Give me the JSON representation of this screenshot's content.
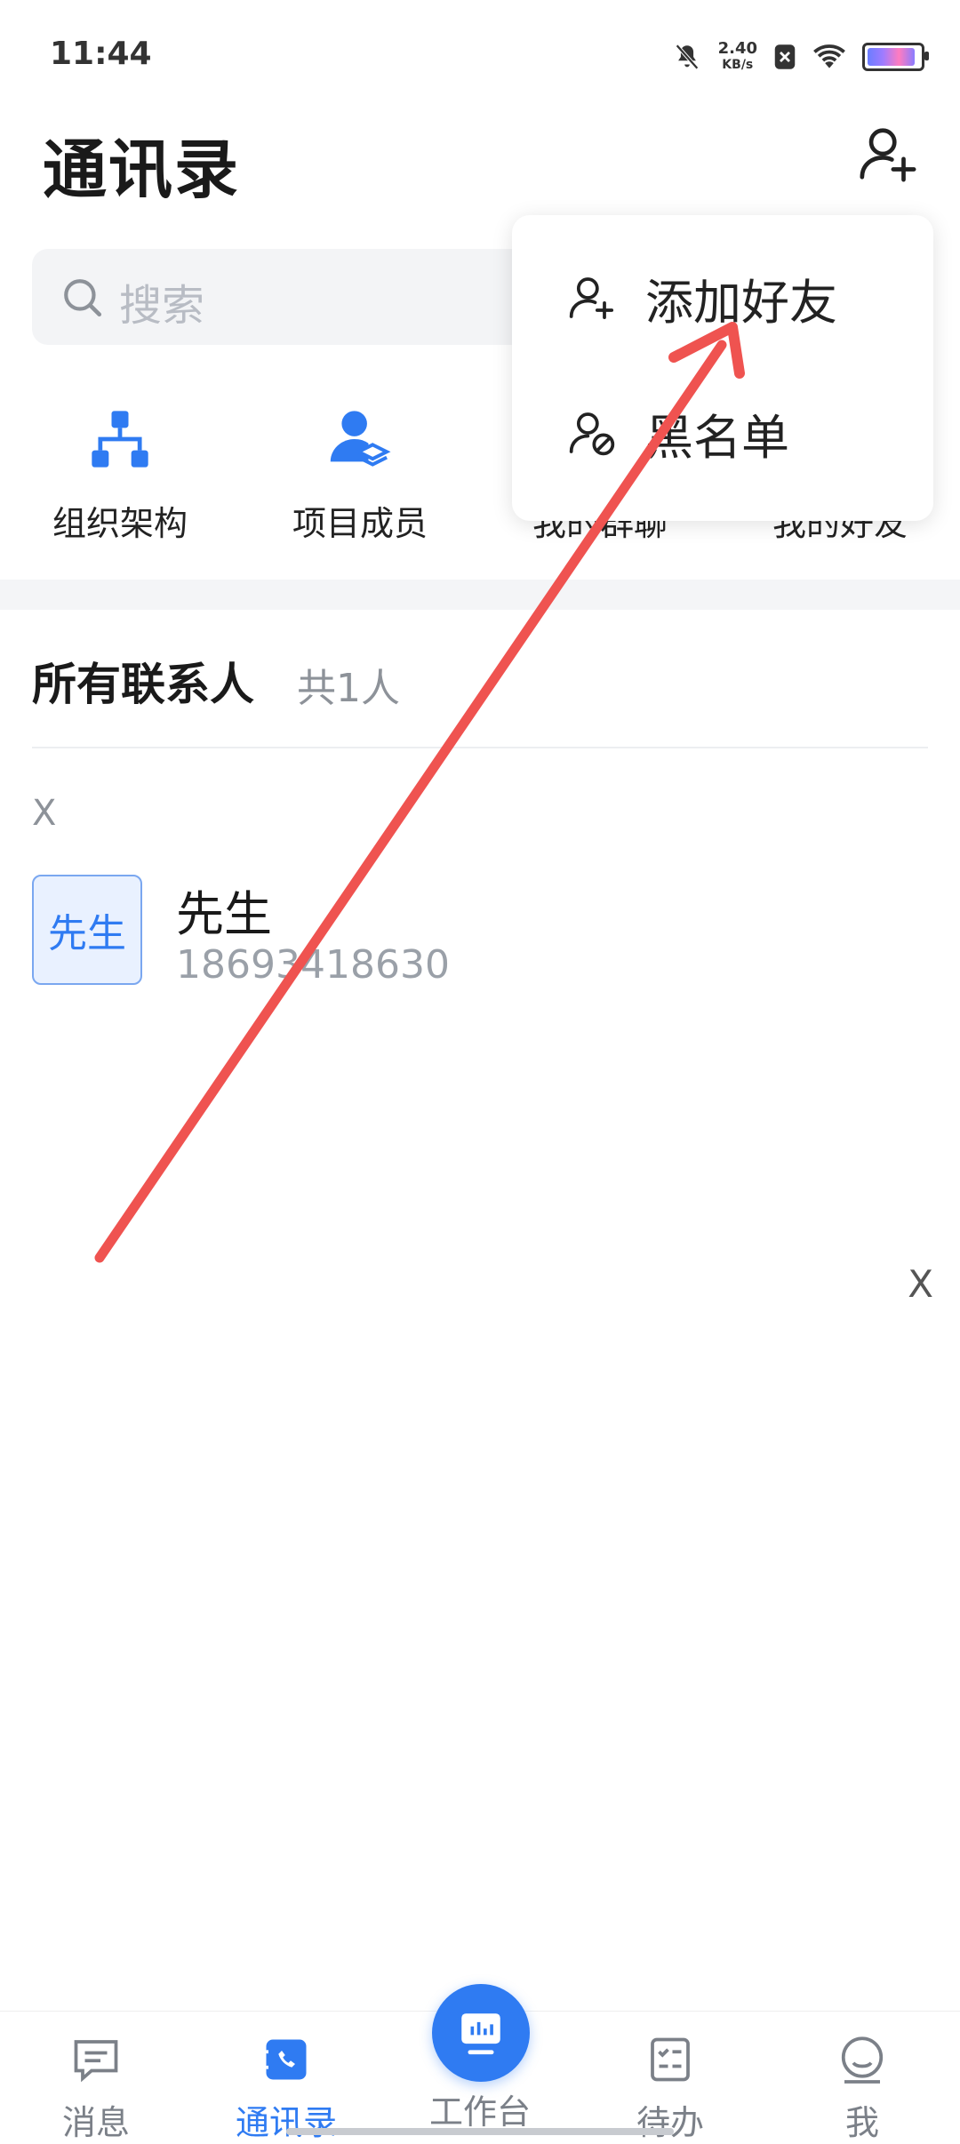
{
  "status_bar": {
    "time": "11:44",
    "net_speed_value": "2.40",
    "net_speed_unit": "KB/s"
  },
  "header": {
    "title": "通讯录"
  },
  "search": {
    "placeholder": "搜索"
  },
  "shortcuts": [
    {
      "label": "组织架构",
      "icon": "org-chart-icon"
    },
    {
      "label": "项目成员",
      "icon": "project-members-icon"
    },
    {
      "label": "我的群聊",
      "icon": "group-chat-icon"
    },
    {
      "label": "我的好友",
      "icon": "friends-icon"
    }
  ],
  "contacts_section": {
    "title": "所有联系人",
    "count": "共1人"
  },
  "index_letter": "X",
  "contacts": [
    {
      "avatar_text": "先生",
      "name": "先生",
      "phone": "18693418630"
    }
  ],
  "side_index": "X",
  "menu": {
    "items": [
      {
        "label": "添加好友",
        "icon": "add-friend-icon"
      },
      {
        "label": "黑名单",
        "icon": "blacklist-icon"
      }
    ]
  },
  "annotation": {
    "color": "#ef5350"
  },
  "tabbar": {
    "items": [
      {
        "label": "消息",
        "icon": "message-icon"
      },
      {
        "label": "通讯录",
        "icon": "contacts-icon",
        "active": true
      },
      {
        "label": "工作台",
        "icon": "workbench-icon"
      },
      {
        "label": "待办",
        "icon": "todo-icon"
      },
      {
        "label": "我",
        "icon": "profile-icon"
      }
    ]
  },
  "colors": {
    "accent": "#2f7bf2",
    "text_secondary": "#8d9299"
  }
}
